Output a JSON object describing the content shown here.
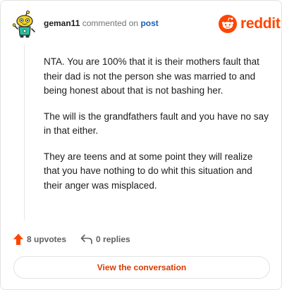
{
  "header": {
    "username": "geman11",
    "action_text": "commented on",
    "post_link_text": "post",
    "logo_text": "reddit"
  },
  "comment": {
    "paragraphs": [
      "NTA. You are 100% that it is their mothers fault that their dad is not the person she was married to and being honest about that is not bashing her.",
      "The will is the grandfathers fault and you have no say in that either.",
      "They are teens and at some point they will realize that you have nothing to do whit this situation and their anger was misplaced."
    ]
  },
  "actions": {
    "upvotes_label": "8 upvotes",
    "replies_label": "0 replies"
  },
  "footer": {
    "view_button_label": "View the conversation"
  },
  "colors": {
    "brand": "#ff4500",
    "link": "#1a5fb4",
    "button_text": "#d93a00",
    "avatar_face": "#f2d61d",
    "avatar_body": "#2dbd9c"
  },
  "icons": {
    "avatar": "snoo-avatar-icon",
    "logo": "reddit-logo-icon",
    "upvote": "upvote-arrow-icon",
    "reply": "reply-arrow-icon"
  }
}
